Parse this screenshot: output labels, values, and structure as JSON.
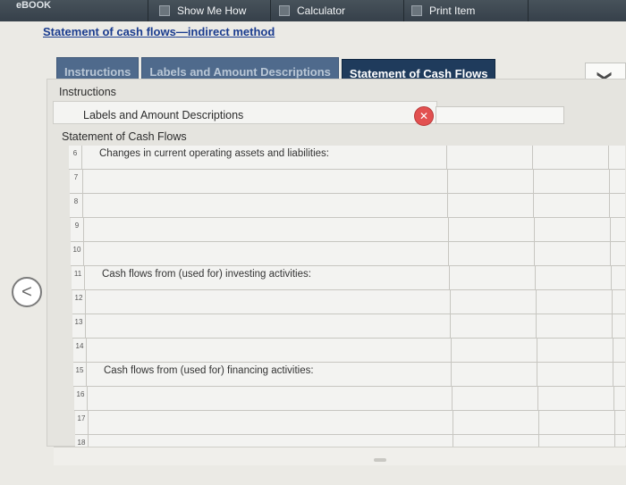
{
  "toolbar": {
    "logo": "eBOOK",
    "show_me_how": "Show Me How",
    "calculator": "Calculator",
    "print_item": "Print Item"
  },
  "page": {
    "title_main": "Statement of cash flows",
    "title_dash": "—",
    "title_sub": "indirect method"
  },
  "tabs": [
    {
      "label": "Instructions"
    },
    {
      "label": "Labels and Amount Descriptions"
    },
    {
      "label": "Statement of Cash Flows"
    }
  ],
  "dropdown": {
    "icon": "chevron-down-icon",
    "glyph": "❯"
  },
  "work": {
    "instructions": "Instructions",
    "labels": "Labels and Amount Descriptions",
    "statement": "Statement of Cash Flows",
    "close_glyph": "✕"
  },
  "rows": [
    {
      "num": "6",
      "label": "Changes in current operating assets and liabilities:"
    },
    {
      "num": "7",
      "label": ""
    },
    {
      "num": "8",
      "label": ""
    },
    {
      "num": "9",
      "label": ""
    },
    {
      "num": "10",
      "label": ""
    },
    {
      "num": "11",
      "label": "Cash flows from (used for) investing activities:"
    },
    {
      "num": "12",
      "label": ""
    },
    {
      "num": "13",
      "label": ""
    },
    {
      "num": "14",
      "label": ""
    },
    {
      "num": "15",
      "label": "Cash flows from (used for) financing activities:"
    },
    {
      "num": "16",
      "label": ""
    },
    {
      "num": "17",
      "label": ""
    },
    {
      "num": "18",
      "label": ""
    }
  ],
  "nav": {
    "back_glyph": "<"
  }
}
